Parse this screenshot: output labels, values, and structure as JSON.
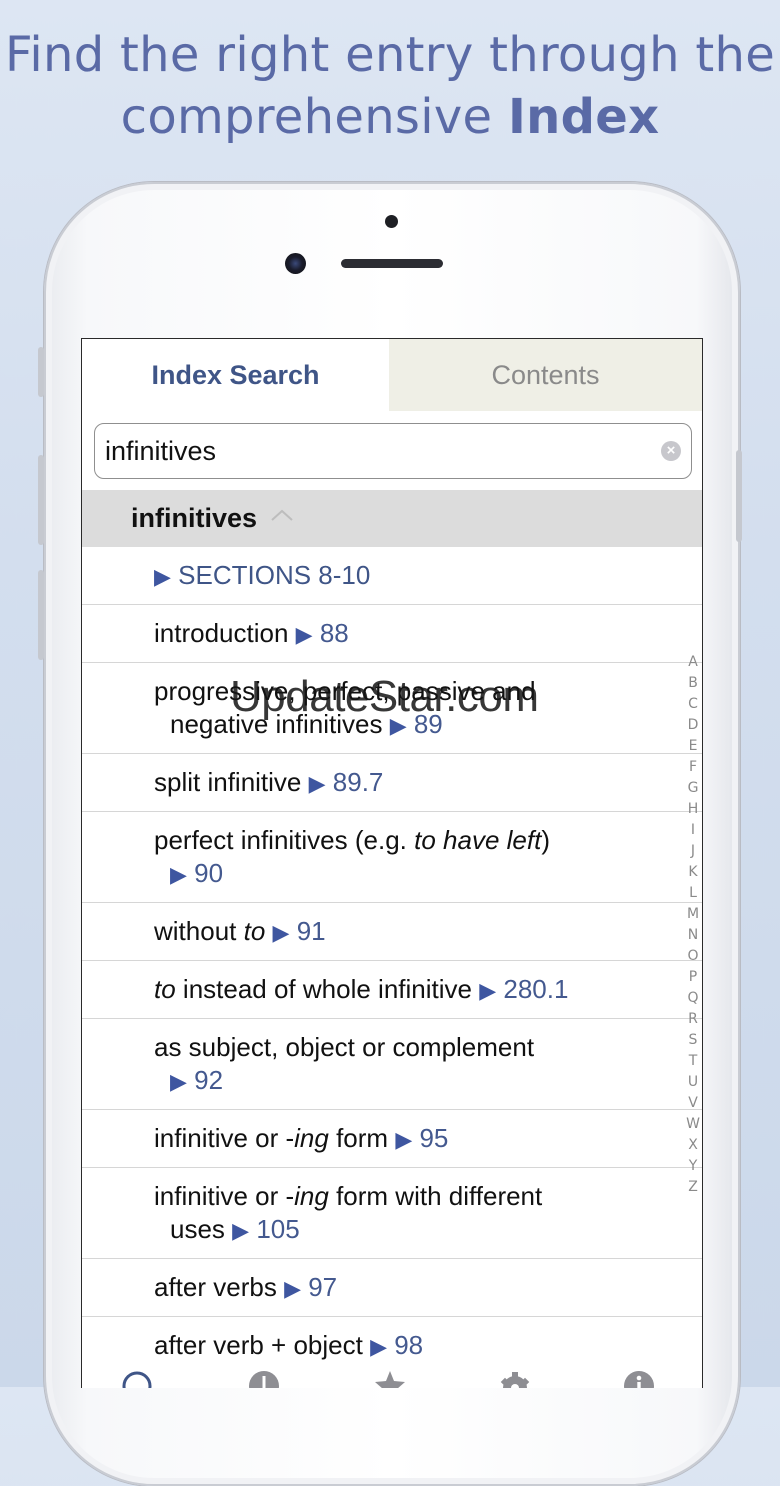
{
  "headline": {
    "line1": "Find the right entry through the",
    "line2_normal": "comprehensive ",
    "line2_bold": "Index"
  },
  "tabs": {
    "index_search": "Index Search",
    "contents": "Contents"
  },
  "search": {
    "value": "infinitives"
  },
  "group": {
    "title": "infinitives"
  },
  "rows": [
    {
      "ref": "SECTIONS 8-10"
    },
    {
      "text": "introduction ",
      "ref": "88"
    },
    {
      "line1": "progressive, perfect, passive and",
      "line2": "negative infinitives ",
      "ref": "89"
    },
    {
      "text": "split infinitive ",
      "ref": "89.7"
    },
    {
      "line1_a": "perfect infinitives (e.g. ",
      "line1_em": "to have left",
      "line1_b": ")",
      "ref": "90"
    },
    {
      "text_a": "without ",
      "text_em": "to",
      "text_b": " ",
      "ref": "91"
    },
    {
      "text_em": "to",
      "text_b": " instead of whole infinitive ",
      "ref": "280.1"
    },
    {
      "line1": "as subject, object or complement",
      "ref": "92"
    },
    {
      "text_a": "infinitive or -",
      "text_em": "ing",
      "text_b": " form ",
      "ref": "95"
    },
    {
      "line1_a": "infinitive or -",
      "line1_em": "ing",
      "line1_b": " form with different",
      "line2": "uses ",
      "ref": "105"
    },
    {
      "text": "after verbs ",
      "ref": "97"
    },
    {
      "text": "after verb + object ",
      "ref": "98"
    }
  ],
  "arrow": "▶",
  "alphabet": [
    "A",
    "B",
    "C",
    "D",
    "E",
    "F",
    "G",
    "H",
    "I",
    "J",
    "K",
    "L",
    "M",
    "N",
    "O",
    "P",
    "Q",
    "R",
    "S",
    "T",
    "U",
    "V",
    "W",
    "X",
    "Y",
    "Z"
  ],
  "watermark": "UpdateStar.com",
  "colors": {
    "accent": "#3f5587",
    "tab_inactive_bg": "#efefe6",
    "group_bg": "#dcdcdc"
  }
}
